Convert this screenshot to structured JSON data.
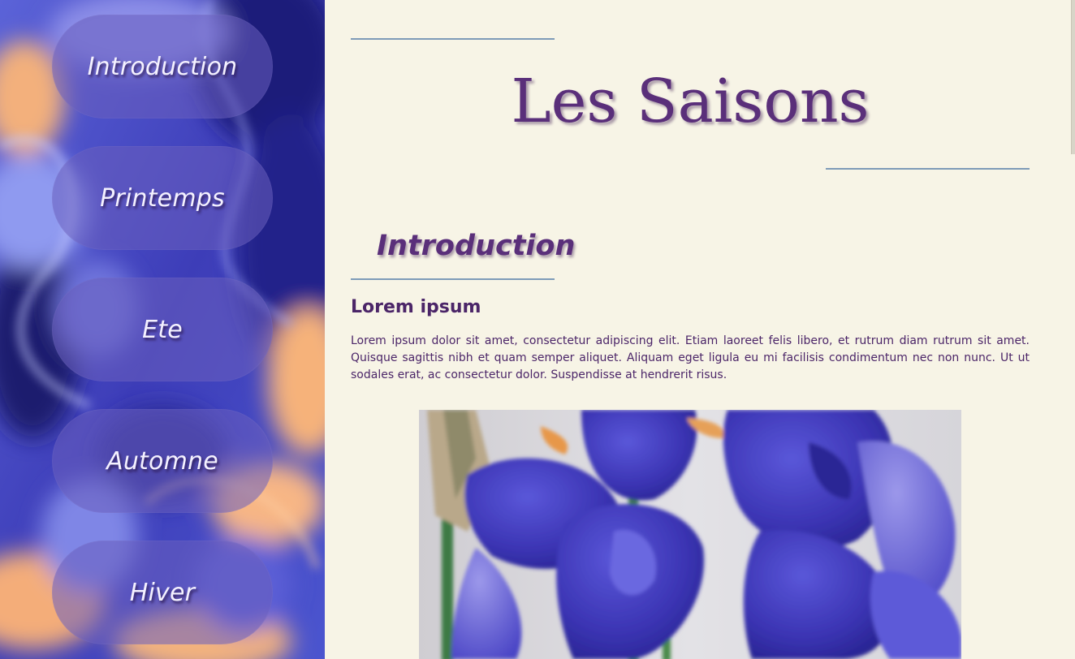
{
  "sidebar": {
    "items": [
      {
        "label": "Introduction"
      },
      {
        "label": "Printemps"
      },
      {
        "label": "Ete"
      },
      {
        "label": "Automne"
      },
      {
        "label": "Hiver"
      }
    ]
  },
  "header": {
    "title": "Les Saisons"
  },
  "section": {
    "heading": "Introduction"
  },
  "article": {
    "title": "Lorem ipsum",
    "body": "Lorem ipsum dolor sit amet, consectetur adipiscing elit. Etiam laoreet felis libero, et rutrum diam rutrum sit amet. Quisque sagittis nibh et quam semper aliquet. Aliquam eget ligula eu mi facilisis condimentum nec non nunc. Ut ut sodales erat, ac consectetur dolor. Suspendisse at hendrerit risus."
  },
  "colors": {
    "accent_purple": "#5a2f7a",
    "rule_blue": "#7e9bb8",
    "page_background": "#f7f4e6",
    "sidebar_blue": "#4a4fc9",
    "sidebar_peach": "#f6b27a"
  }
}
